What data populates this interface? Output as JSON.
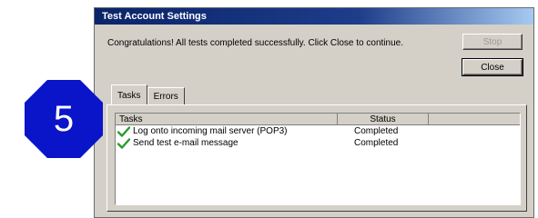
{
  "step_badge": {
    "number": "5",
    "color": "#0a14c8"
  },
  "dialog": {
    "title": "Test Account Settings",
    "message": "Congratulations! All tests completed successfully. Click Close to continue.",
    "buttons": {
      "stop_label": "Stop",
      "close_label": "Close"
    },
    "tabs": [
      {
        "label": "Tasks",
        "active": true
      },
      {
        "label": "Errors",
        "active": false
      }
    ],
    "list": {
      "columns": {
        "tasks": "Tasks",
        "status": "Status"
      },
      "rows": [
        {
          "icon": "check-icon",
          "task": "Log onto incoming mail server (POP3)",
          "status": "Completed"
        },
        {
          "icon": "check-icon",
          "task": "Send test e-mail message",
          "status": "Completed"
        }
      ]
    }
  },
  "colors": {
    "titlebar": "#0a246a",
    "check": "#2e9a2e",
    "window": "#d4d0c8"
  }
}
